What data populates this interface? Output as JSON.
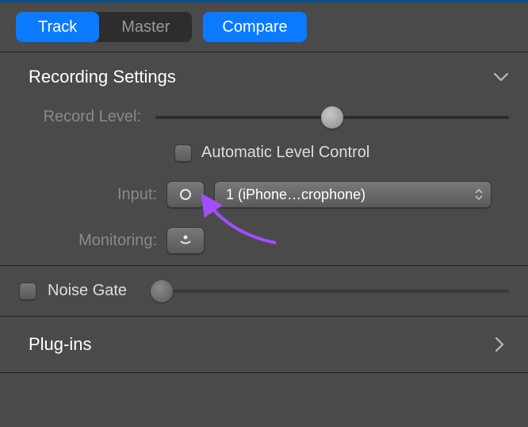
{
  "colors": {
    "accent": "#0a7aff"
  },
  "tabs": {
    "track": "Track",
    "master": "Master",
    "compare": "Compare"
  },
  "sections": {
    "recording": {
      "title": "Recording Settings",
      "record_level_label": "Record Level:",
      "record_level_value": 50,
      "auto_level_label": "Automatic Level Control",
      "auto_level_checked": false,
      "input_label": "Input:",
      "input_channel": "mono",
      "input_source": "1  (iPhone…crophone)",
      "monitoring_label": "Monitoring:",
      "monitoring_on": false
    },
    "noise_gate": {
      "label": "Noise Gate",
      "checked": false,
      "value": 0
    },
    "plugins": {
      "label": "Plug-ins"
    }
  }
}
